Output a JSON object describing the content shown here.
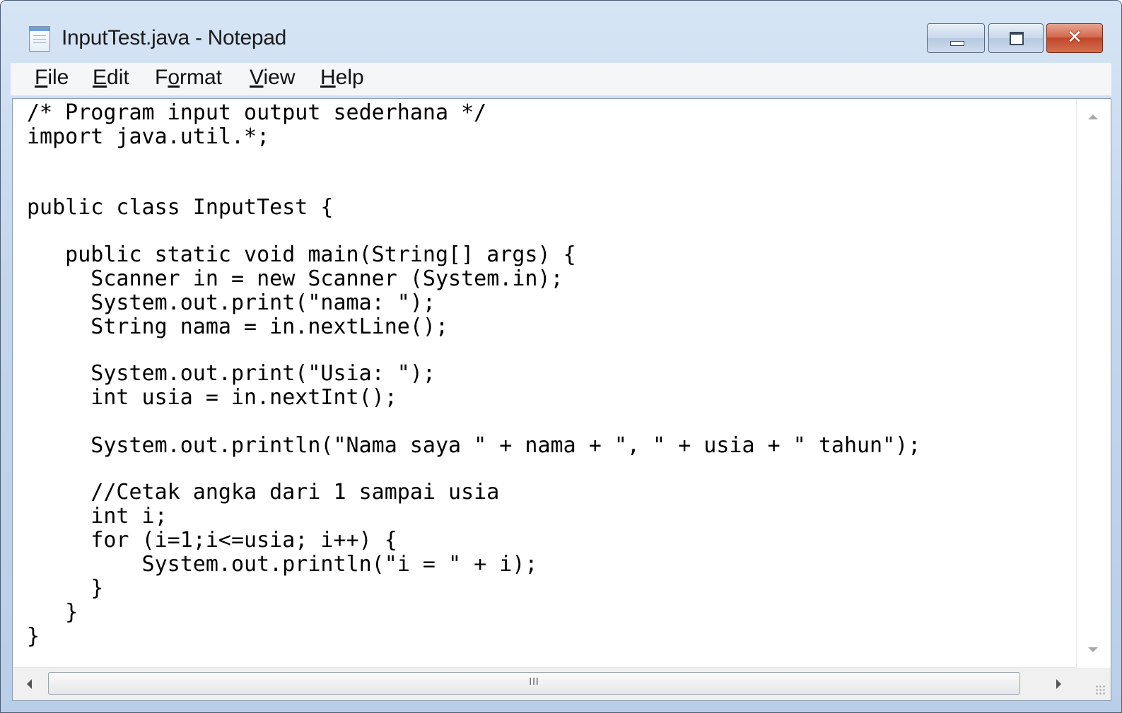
{
  "window": {
    "title": "InputTest.java - Notepad"
  },
  "titlebar": {
    "close_glyph": "✕"
  },
  "menu": {
    "items": [
      {
        "label": "File",
        "mnemonic_index": 0
      },
      {
        "label": "Edit",
        "mnemonic_index": 0
      },
      {
        "label": "Format",
        "mnemonic_index": 1
      },
      {
        "label": "View",
        "mnemonic_index": 0
      },
      {
        "label": "Help",
        "mnemonic_index": 0
      }
    ]
  },
  "editor": {
    "lines": [
      "/* Program input output sederhana */",
      "import java.util.*;",
      "",
      "",
      "public class InputTest {",
      "",
      "   public static void main(String[] args) {",
      "     Scanner in = new Scanner (System.in);",
      "     System.out.print(\"nama: \");",
      "     String nama = in.nextLine();",
      "",
      "     System.out.print(\"Usia: \");",
      "     int usia = in.nextInt();",
      "",
      "     System.out.println(\"Nama saya \" + nama + \", \" + usia + \" tahun\");",
      "",
      "     //Cetak angka dari 1 sampai usia",
      "     int i;",
      "     for (i=1;i<=usia; i++) {",
      "         System.out.println(\"i = \" + i);",
      "     }",
      "   }",
      "}"
    ]
  },
  "scrollbar": {
    "grip_glyph": "III"
  },
  "colors": {
    "frame": "#c3d6ec",
    "close_button": "#c1462a",
    "text": "#000000"
  }
}
